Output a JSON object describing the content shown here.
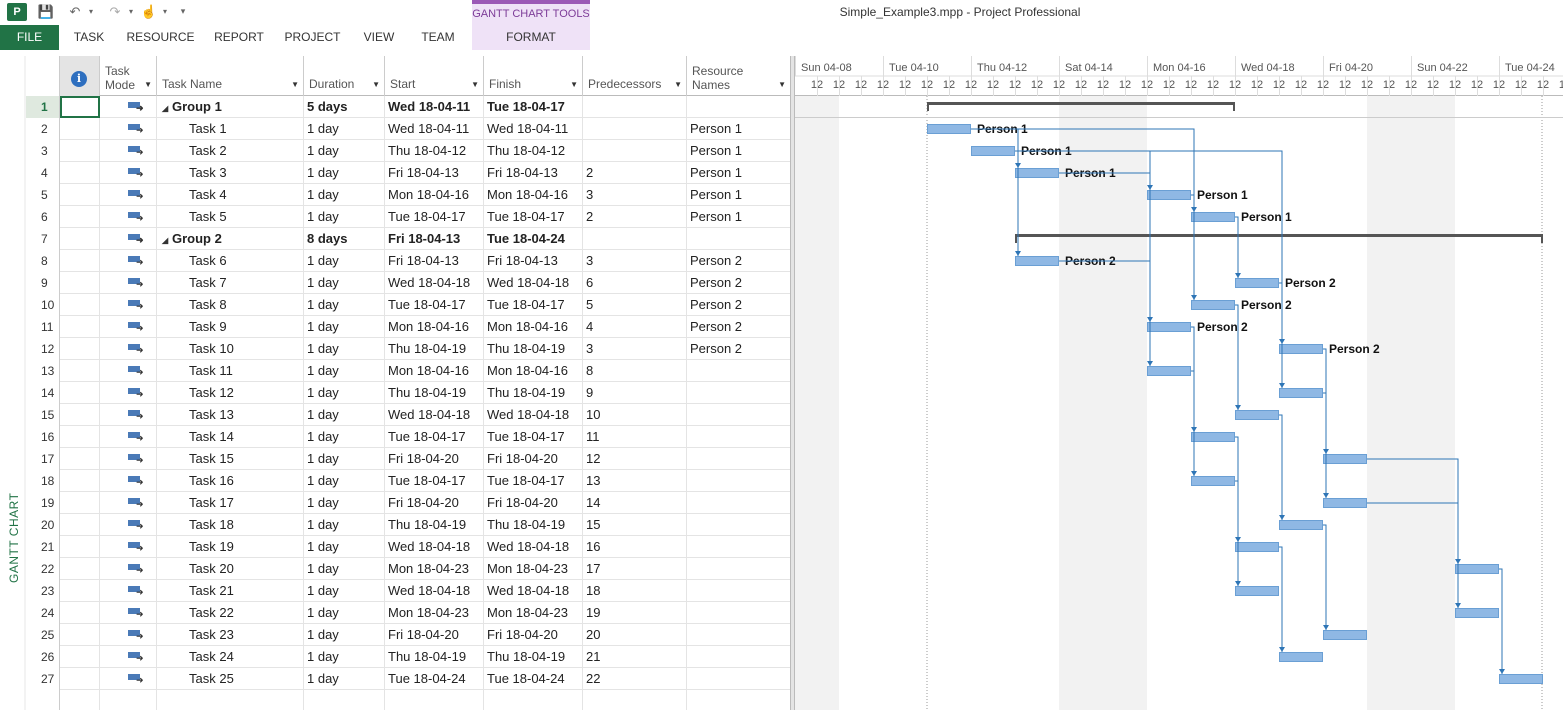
{
  "app": {
    "logo": "P",
    "window_title": "Simple_Example3.mpp - Project Professional",
    "contextual_group": "GANTT CHART TOOLS",
    "view_name": "GANTT CHART"
  },
  "icons": {
    "app_logo": "project-logo-icon",
    "save": "💾",
    "undo": "↶",
    "redo": "↷",
    "touch": "☝",
    "dropdown": "▾",
    "customize": "▾",
    "info": "i",
    "collapse": "◢",
    "col_arrow": "▼"
  },
  "ribbon": {
    "tabs": [
      {
        "id": "file",
        "label": "FILE"
      },
      {
        "id": "task",
        "label": "TASK"
      },
      {
        "id": "resource",
        "label": "RESOURCE"
      },
      {
        "id": "report",
        "label": "REPORT"
      },
      {
        "id": "project",
        "label": "PROJECT"
      },
      {
        "id": "view",
        "label": "VIEW"
      },
      {
        "id": "team",
        "label": "TEAM"
      },
      {
        "id": "format",
        "label": "FORMAT"
      }
    ]
  },
  "grid": {
    "columns": {
      "task_mode_1": "Task",
      "task_mode_2": "Mode",
      "task_name": "Task Name",
      "duration": "Duration",
      "start": "Start",
      "finish": "Finish",
      "predecessors": "Predecessors",
      "resource_1": "Resource",
      "resource_2": "Names"
    },
    "rows": [
      {
        "id": "1",
        "name": "Group 1",
        "summary": true,
        "duration": "5 days",
        "start": "Wed 18-04-11",
        "finish": "Tue 18-04-17",
        "pred": "",
        "res": ""
      },
      {
        "id": "2",
        "name": "Task 1",
        "summary": false,
        "duration": "1 day",
        "start": "Wed 18-04-11",
        "finish": "Wed 18-04-11",
        "pred": "",
        "res": "Person 1"
      },
      {
        "id": "3",
        "name": "Task 2",
        "summary": false,
        "duration": "1 day",
        "start": "Thu 18-04-12",
        "finish": "Thu 18-04-12",
        "pred": "",
        "res": "Person 1"
      },
      {
        "id": "4",
        "name": "Task 3",
        "summary": false,
        "duration": "1 day",
        "start": "Fri 18-04-13",
        "finish": "Fri 18-04-13",
        "pred": "2",
        "res": "Person 1"
      },
      {
        "id": "5",
        "name": "Task 4",
        "summary": false,
        "duration": "1 day",
        "start": "Mon 18-04-16",
        "finish": "Mon 18-04-16",
        "pred": "3",
        "res": "Person 1"
      },
      {
        "id": "6",
        "name": "Task 5",
        "summary": false,
        "duration": "1 day",
        "start": "Tue 18-04-17",
        "finish": "Tue 18-04-17",
        "pred": "2",
        "res": "Person 1"
      },
      {
        "id": "7",
        "name": "Group 2",
        "summary": true,
        "duration": "8 days",
        "start": "Fri 18-04-13",
        "finish": "Tue 18-04-24",
        "pred": "",
        "res": ""
      },
      {
        "id": "8",
        "name": "Task 6",
        "summary": false,
        "duration": "1 day",
        "start": "Fri 18-04-13",
        "finish": "Fri 18-04-13",
        "pred": "3",
        "res": "Person 2"
      },
      {
        "id": "9",
        "name": "Task 7",
        "summary": false,
        "duration": "1 day",
        "start": "Wed 18-04-18",
        "finish": "Wed 18-04-18",
        "pred": "6",
        "res": "Person 2"
      },
      {
        "id": "10",
        "name": "Task 8",
        "summary": false,
        "duration": "1 day",
        "start": "Tue 18-04-17",
        "finish": "Tue 18-04-17",
        "pred": "5",
        "res": "Person 2"
      },
      {
        "id": "11",
        "name": "Task 9",
        "summary": false,
        "duration": "1 day",
        "start": "Mon 18-04-16",
        "finish": "Mon 18-04-16",
        "pred": "4",
        "res": "Person 2"
      },
      {
        "id": "12",
        "name": "Task 10",
        "summary": false,
        "duration": "1 day",
        "start": "Thu 18-04-19",
        "finish": "Thu 18-04-19",
        "pred": "3",
        "res": "Person 2"
      },
      {
        "id": "13",
        "name": "Task 11",
        "summary": false,
        "duration": "1 day",
        "start": "Mon 18-04-16",
        "finish": "Mon 18-04-16",
        "pred": "8",
        "res": ""
      },
      {
        "id": "14",
        "name": "Task 12",
        "summary": false,
        "duration": "1 day",
        "start": "Thu 18-04-19",
        "finish": "Thu 18-04-19",
        "pred": "9",
        "res": ""
      },
      {
        "id": "15",
        "name": "Task 13",
        "summary": false,
        "duration": "1 day",
        "start": "Wed 18-04-18",
        "finish": "Wed 18-04-18",
        "pred": "10",
        "res": ""
      },
      {
        "id": "16",
        "name": "Task 14",
        "summary": false,
        "duration": "1 day",
        "start": "Tue 18-04-17",
        "finish": "Tue 18-04-17",
        "pred": "11",
        "res": ""
      },
      {
        "id": "17",
        "name": "Task 15",
        "summary": false,
        "duration": "1 day",
        "start": "Fri 18-04-20",
        "finish": "Fri 18-04-20",
        "pred": "12",
        "res": ""
      },
      {
        "id": "18",
        "name": "Task 16",
        "summary": false,
        "duration": "1 day",
        "start": "Tue 18-04-17",
        "finish": "Tue 18-04-17",
        "pred": "13",
        "res": ""
      },
      {
        "id": "19",
        "name": "Task 17",
        "summary": false,
        "duration": "1 day",
        "start": "Fri 18-04-20",
        "finish": "Fri 18-04-20",
        "pred": "14",
        "res": ""
      },
      {
        "id": "20",
        "name": "Task 18",
        "summary": false,
        "duration": "1 day",
        "start": "Thu 18-04-19",
        "finish": "Thu 18-04-19",
        "pred": "15",
        "res": ""
      },
      {
        "id": "21",
        "name": "Task 19",
        "summary": false,
        "duration": "1 day",
        "start": "Wed 18-04-18",
        "finish": "Wed 18-04-18",
        "pred": "16",
        "res": ""
      },
      {
        "id": "22",
        "name": "Task 20",
        "summary": false,
        "duration": "1 day",
        "start": "Mon 18-04-23",
        "finish": "Mon 18-04-23",
        "pred": "17",
        "res": ""
      },
      {
        "id": "23",
        "name": "Task 21",
        "summary": false,
        "duration": "1 day",
        "start": "Wed 18-04-18",
        "finish": "Wed 18-04-18",
        "pred": "18",
        "res": ""
      },
      {
        "id": "24",
        "name": "Task 22",
        "summary": false,
        "duration": "1 day",
        "start": "Mon 18-04-23",
        "finish": "Mon 18-04-23",
        "pred": "19",
        "res": ""
      },
      {
        "id": "25",
        "name": "Task 23",
        "summary": false,
        "duration": "1 day",
        "start": "Fri 18-04-20",
        "finish": "Fri 18-04-20",
        "pred": "20",
        "res": ""
      },
      {
        "id": "26",
        "name": "Task 24",
        "summary": false,
        "duration": "1 day",
        "start": "Thu 18-04-19",
        "finish": "Thu 18-04-19",
        "pred": "21",
        "res": ""
      },
      {
        "id": "27",
        "name": "Task 25",
        "summary": false,
        "duration": "1 day",
        "start": "Tue 18-04-24",
        "finish": "Tue 18-04-24",
        "pred": "22",
        "res": ""
      }
    ],
    "selected_row": "1"
  },
  "gantt": {
    "timescale_top": [
      "Sun 04-08",
      "Tue 04-10",
      "Thu 04-12",
      "Sat 04-14",
      "Mon 04-16",
      "Wed 04-18",
      "Fri 04-20",
      "Sun 04-22",
      "Tue 04-24"
    ],
    "timescale_bottom_label": "12",
    "timeline_start": "2018-04-08",
    "timeline_end": "2018-04-25",
    "nonworking_days": [
      "2018-04-08",
      "2018-04-14",
      "2018-04-15",
      "2018-04-21",
      "2018-04-22"
    ],
    "status_line_date": "2018-04-11",
    "colors": {
      "task_bar": "#8fb8e4",
      "task_bar_border": "#6a9fd4",
      "summary_bar": "#555555",
      "link": "#2e75b6",
      "nonworking": "#f2f2f2",
      "divider": "#bbbbbb"
    }
  }
}
